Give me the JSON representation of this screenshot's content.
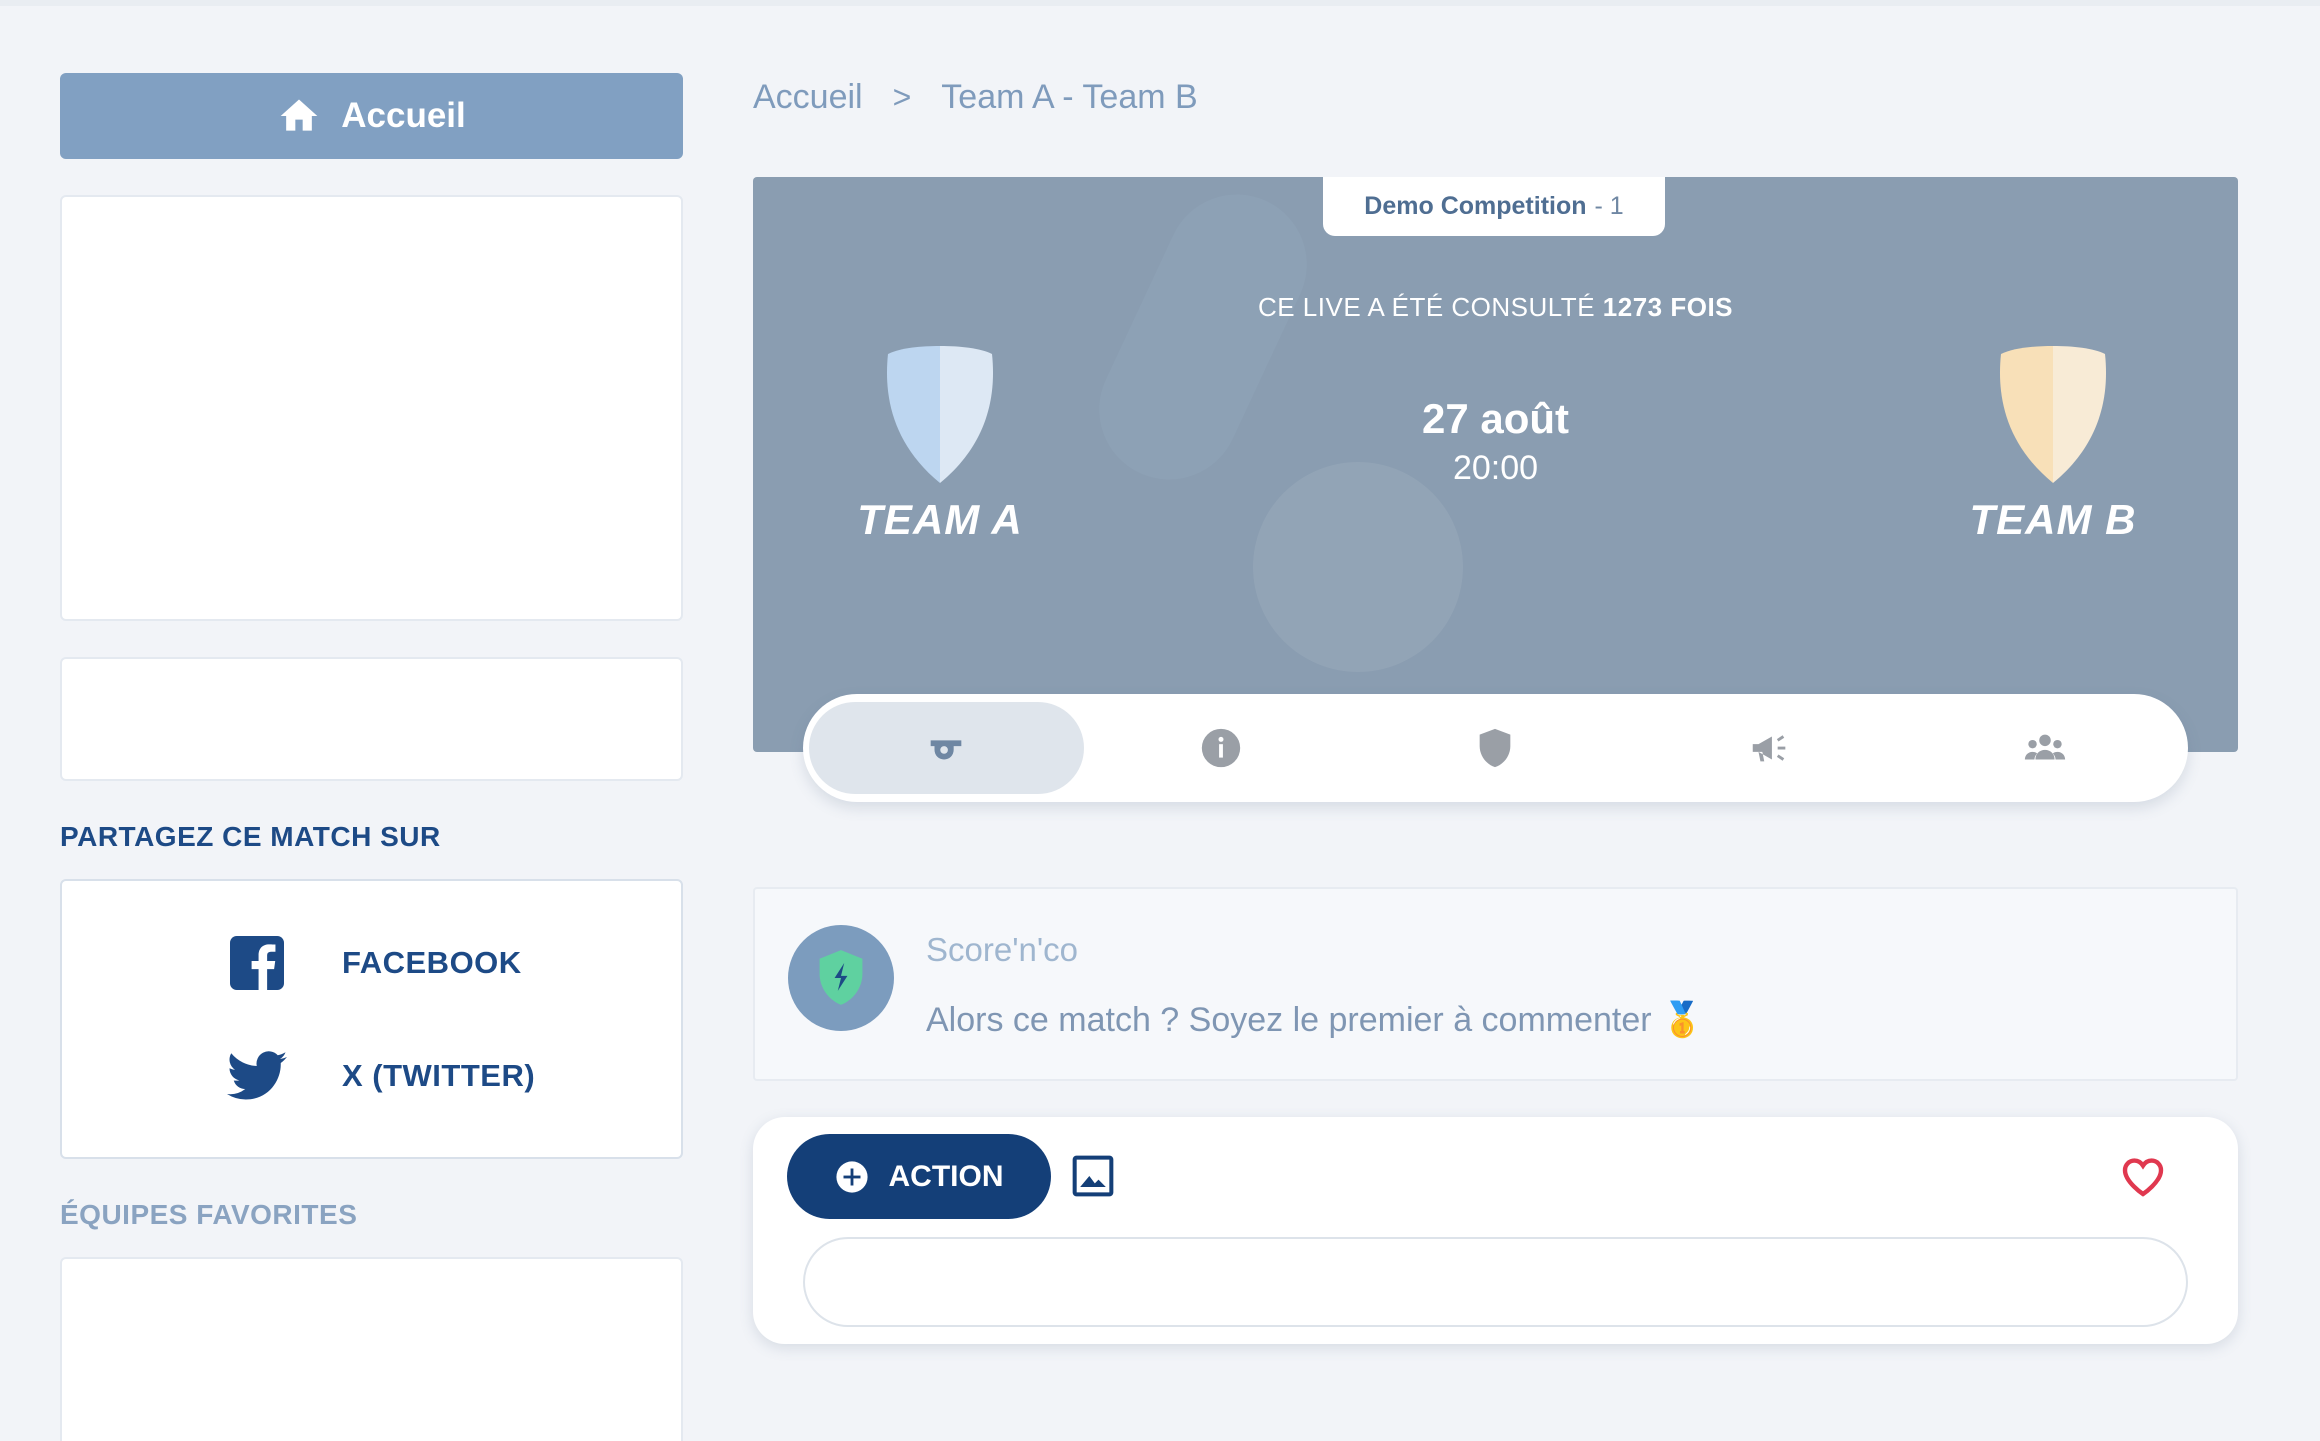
{
  "sidebar": {
    "home_label": "Accueil",
    "share_title": "PARTAGEZ CE MATCH SUR",
    "share_items": [
      {
        "label": "FACEBOOK",
        "icon": "facebook-icon"
      },
      {
        "label": "X (TWITTER)",
        "icon": "twitter-icon"
      }
    ],
    "favorites_title": "ÉQUIPES FAVORITES"
  },
  "breadcrumb": {
    "home": "Accueil",
    "separator": ">",
    "current": "Team A - Team B"
  },
  "match": {
    "competition_name": "Demo Competition",
    "competition_round": "- 1",
    "views_prefix": "CE LIVE A ÉTÉ CONSULTÉ",
    "views_count": "1273 FOIS",
    "date": "27 août",
    "time": "20:00",
    "team_a": {
      "name": "TEAM A",
      "color_left": "#bdd6f0",
      "color_right": "#dde8f4"
    },
    "team_b": {
      "name": "TEAM B",
      "color_left": "#f8e0b8",
      "color_right": "#f8ebd6"
    }
  },
  "tabs": [
    {
      "icon": "whistle-icon",
      "active": true
    },
    {
      "icon": "info-icon",
      "active": false
    },
    {
      "icon": "shield-icon",
      "active": false
    },
    {
      "icon": "megaphone-icon",
      "active": false
    },
    {
      "icon": "group-icon",
      "active": false
    }
  ],
  "comment": {
    "author": "Score'n'co",
    "message": "Alors ce match ? Soyez le premier à commenter 🥇"
  },
  "composer": {
    "action_label": "ACTION",
    "input_placeholder": ""
  },
  "colors": {
    "primary": "#143f78",
    "accent_heart": "#e0384f",
    "hero_bg": "#8a9db1"
  }
}
